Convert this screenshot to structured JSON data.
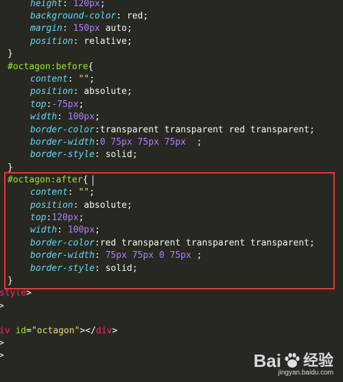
{
  "colors": {
    "background": "#272822",
    "highlight_border": "#E53935"
  },
  "code": {
    "l1_prop": "height",
    "l1_colon": ": ",
    "l1_val": "120px",
    "l1_end": ";",
    "l2_prop": "background-color",
    "l2_colon": ": ",
    "l2_val": "red",
    "l2_end": ";",
    "l3_prop": "margin",
    "l3_colon": ": ",
    "l3_num": "150px",
    "l3_val": " auto",
    "l3_end": ";",
    "l4_prop": "position",
    "l4_colon": ": ",
    "l4_val": "relative",
    "l4_end": ";",
    "l5_brace": "}",
    "l6_sel": "#octagon:before",
    "l6_brace": "{",
    "l7_prop": "content",
    "l7_colon": ": ",
    "l7_str": "\"\"",
    "l7_end": ";",
    "l8_prop": "position",
    "l8_colon": ": ",
    "l8_val": "absolute",
    "l8_end": ";",
    "l9_prop": "top",
    "l9_colon": ":",
    "l9_num": "-75px",
    "l9_end": ";",
    "l10_prop": "width",
    "l10_colon": ": ",
    "l10_num": "100px",
    "l10_end": ";",
    "l11_prop": "border-color",
    "l11_colon": ":",
    "l11_val": "transparent transparent red transparent",
    "l11_end": ";",
    "l12_prop": "border-width",
    "l12_colon": ":",
    "l12_val": "0 75px 75px 75px",
    "l12_end": "  ;",
    "l13_prop": "border-style",
    "l13_colon": ": ",
    "l13_val": "solid",
    "l13_end": ";",
    "l14_brace": "}",
    "l15_sel": "#octagon:after",
    "l15_brace": "{",
    "l16_prop": "content",
    "l16_colon": ": ",
    "l16_str": "\"\"",
    "l16_end": ";",
    "l17_prop": "position",
    "l17_colon": ": ",
    "l17_val": "absolute",
    "l17_end": ";",
    "l18_prop": "top",
    "l18_colon": ":",
    "l18_num": "120px",
    "l18_end": ";",
    "l19_prop": "width",
    "l19_colon": ": ",
    "l19_num": "100px",
    "l19_end": ";",
    "l20_prop": "border-color",
    "l20_colon": ":",
    "l20_val": "red transparent transparent transparent",
    "l20_end": ";",
    "l21_prop": "border-width",
    "l21_colon": ": ",
    "l21_val": "75px 75px 0 75px",
    "l21_end": " ;",
    "l22_prop": "border-style",
    "l22_colon": ": ",
    "l22_val": "solid",
    "l22_end": ";",
    "l23_brace": "}",
    "l24_tag": "style",
    "l24_end": ">",
    "l25_brace": ">",
    "l26_blank": "",
    "l27_tag": "iv",
    "l27_attr": " id",
    "l27_eq": "=",
    "l27_str": "\"octagon\"",
    "l27_mid": "></",
    "l27_tag2": "div",
    "l27_end": ">",
    "l28_brace": ">",
    "l29_brace": ">"
  },
  "watermark": {
    "brand_left": "Bai",
    "brand_right": "经验",
    "url": "jingyan.baidu.com"
  }
}
